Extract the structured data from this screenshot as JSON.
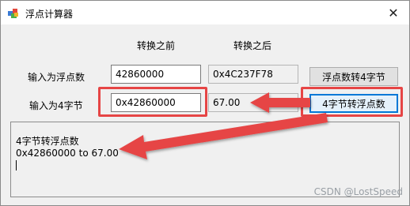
{
  "window": {
    "title": "浮点计算器",
    "close_glyph": "✕"
  },
  "headers": {
    "before": "转换之前",
    "after": "转换之后"
  },
  "row_float": {
    "label": "输入为浮点数",
    "input_value": "42860000",
    "output_value": "0x4C237F78",
    "button_label": "浮点数转4字节"
  },
  "row_bytes": {
    "label": "输入为4字节",
    "input_value": "0x42860000",
    "output_value": "67.00",
    "button_label": "4字节转浮点数"
  },
  "output_log": {
    "line1": "4字节转浮点数",
    "line2": "0x42860000 to 67.00"
  },
  "watermark": "CSDN @LostSpeed",
  "colors": {
    "highlight": "#e64545",
    "focus": "#0078d7"
  }
}
